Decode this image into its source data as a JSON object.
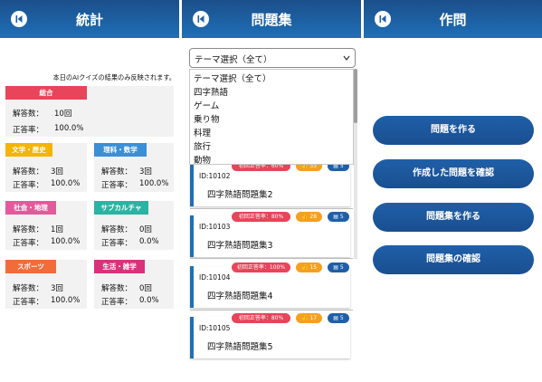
{
  "colors": {
    "header_start": "#1b4f8a",
    "header_end": "#1f6fb8",
    "red": "#e8445a",
    "orange": "#f4a020",
    "blue": "#1f5fa8",
    "cat_total": "#e8445a",
    "cat_literature": "#f4b400",
    "cat_science": "#3a8fd6",
    "cat_social": "#e35a9b",
    "cat_subculture": "#2bb3a3",
    "cat_sports": "#f26b3a",
    "cat_life": "#d9327a"
  },
  "stats_screen": {
    "title": "統計",
    "back_icon": "back-arrow-icon",
    "note": "本日のAIクイズの結果のみ反映されます。",
    "answer_label": "解答数：",
    "rate_label": "正答率：",
    "total": {
      "tag": "総合",
      "answers": "10回",
      "rate": "100.0%"
    },
    "categories": [
      {
        "tag": "文学・歴史",
        "answers": "3回",
        "rate": "100.0%",
        "color": "#f4b400"
      },
      {
        "tag": "理科・数学",
        "answers": "3回",
        "rate": "100.0%",
        "color": "#3a8fd6"
      },
      {
        "tag": "社会・地理",
        "answers": "1回",
        "rate": "100.0%",
        "color": "#e35a9b"
      },
      {
        "tag": "サブカルチャ",
        "answers": "0回",
        "rate": "0.0%",
        "color": "#2bb3a3"
      },
      {
        "tag": "スポーツ",
        "answers": "3回",
        "rate": "100.0%",
        "color": "#f26b3a"
      },
      {
        "tag": "生活・雑学",
        "answers": "0回",
        "rate": "0.0%",
        "color": "#d9327a"
      }
    ]
  },
  "quizset_screen": {
    "title": "問題集",
    "select_value": "テーマ選択（全て）",
    "options": [
      "テーマ選択（全て）",
      "四字熟語",
      "ゲーム",
      "乗り物",
      "料理",
      "旅行",
      "動物"
    ],
    "items": [
      {
        "id": "ID:10102",
        "rate": "初回正答率：60%",
        "likes": "33",
        "count": "5",
        "title": "四字熟語問題集2"
      },
      {
        "id": "ID:10103",
        "rate": "初回正答率：80%",
        "likes": "28",
        "count": "5",
        "title": "四字熟語問題集3"
      },
      {
        "id": "ID:10104",
        "rate": "初回正答率：100%",
        "likes": "15",
        "count": "5",
        "title": "四字熟語問題集4"
      },
      {
        "id": "ID:10105",
        "rate": "初回正答率：80%",
        "likes": "17",
        "count": "5",
        "title": "四字熟語問題集5"
      }
    ]
  },
  "create_screen": {
    "title": "作問",
    "buttons": [
      "問題を作る",
      "作成した問題を確認",
      "問題集を作る",
      "問題集の確認"
    ]
  }
}
